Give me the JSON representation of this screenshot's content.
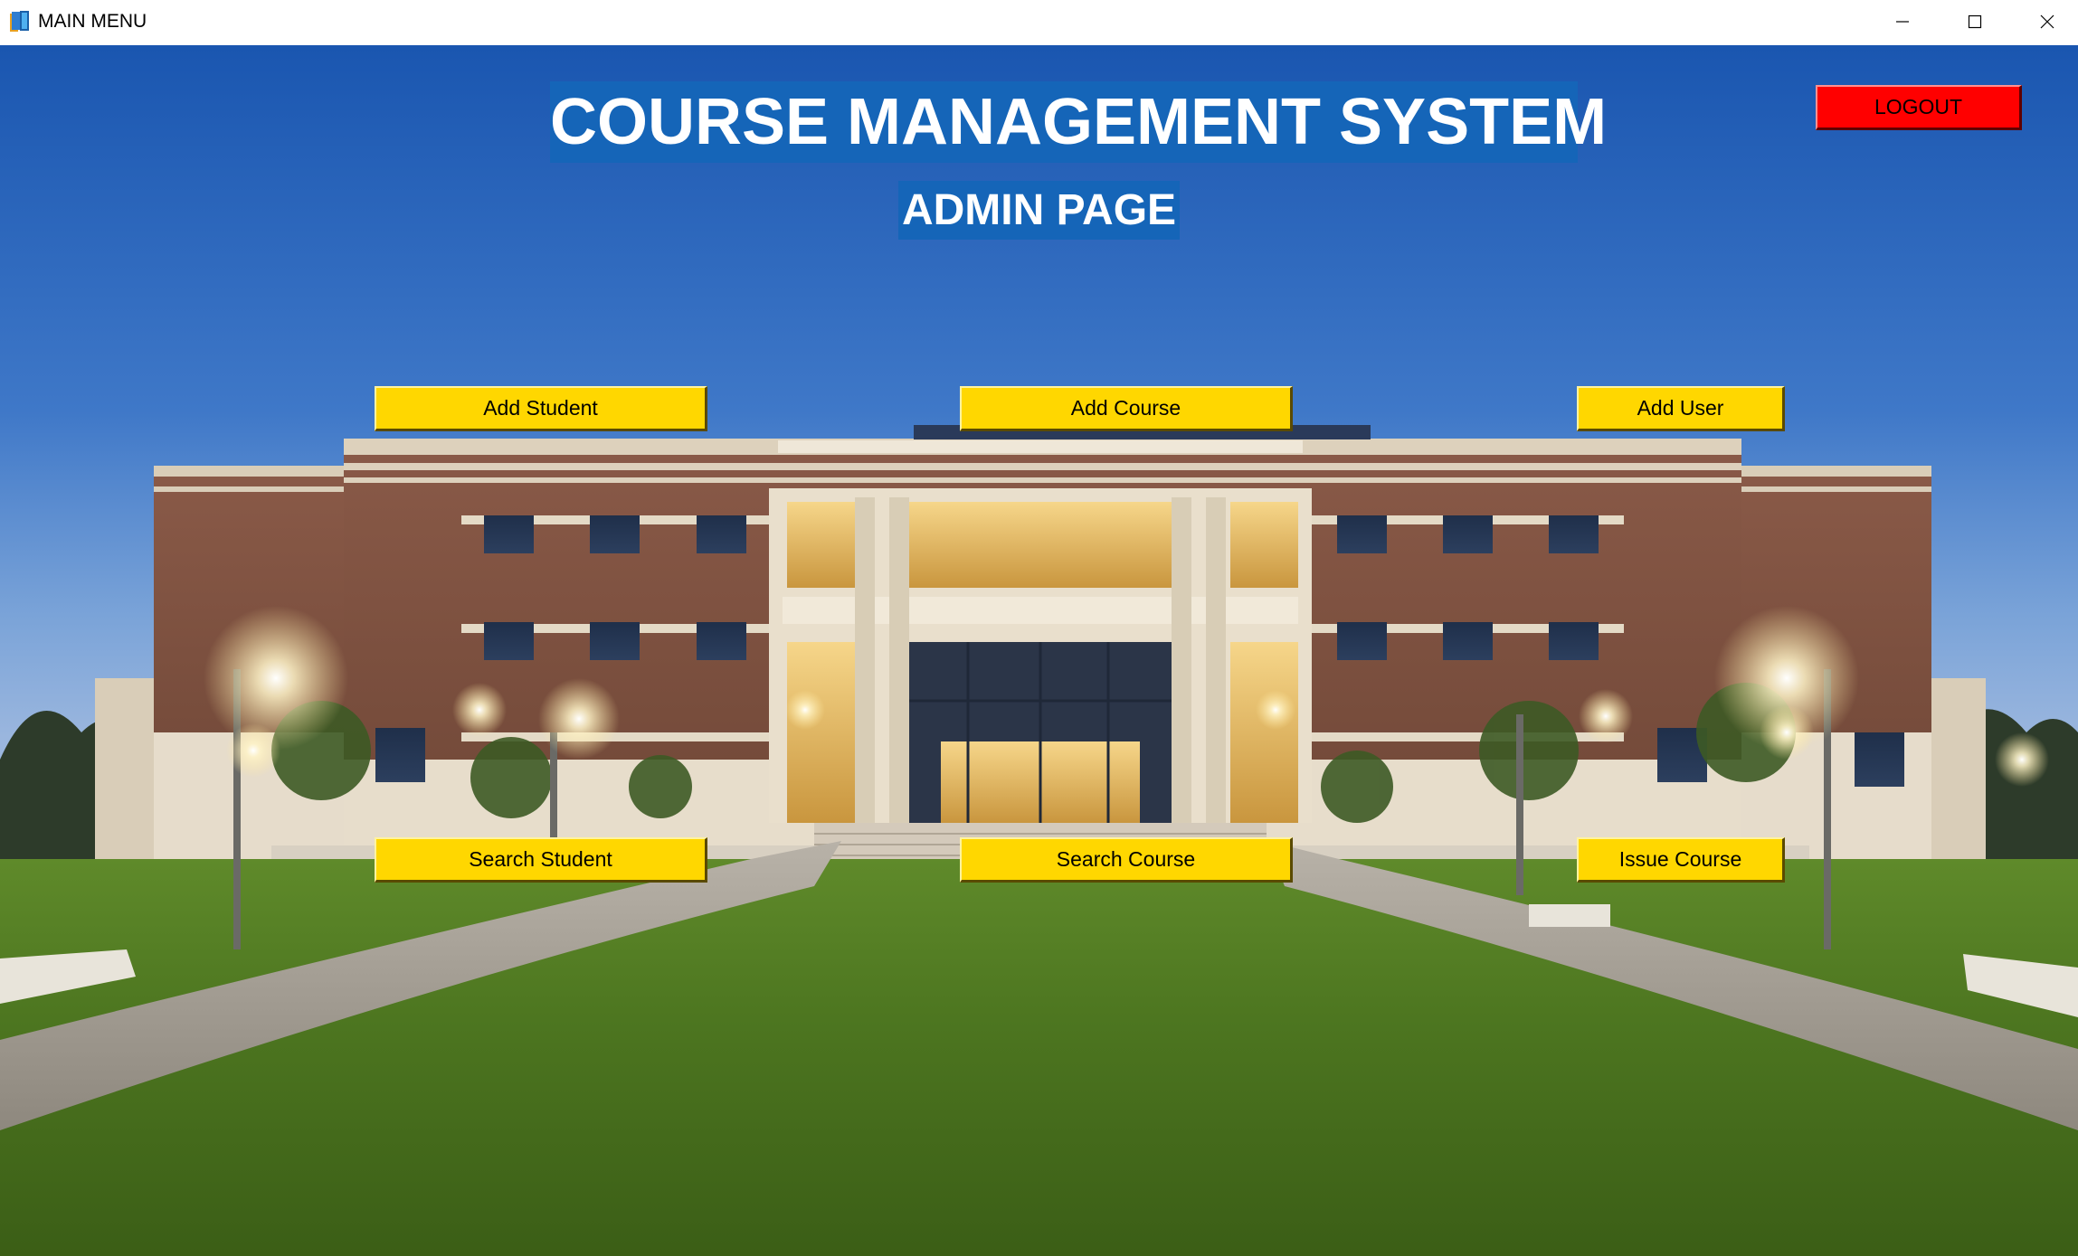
{
  "window": {
    "title": "MAIN MENU",
    "app_icon": "book-app-icon",
    "controls": [
      "minimize-icon",
      "maximize-icon",
      "close-icon"
    ]
  },
  "header": {
    "title": "COURSE MANAGEMENT SYSTEM",
    "subtitle": "ADMIN PAGE",
    "logout_label": "LOGOUT"
  },
  "actions": {
    "add_student": "Add Student",
    "add_course": "Add Course",
    "add_user": "Add User",
    "search_student": "Search Student",
    "search_course": "Search Course",
    "issue_course": "Issue Course"
  },
  "colors": {
    "heading_bg": "#1565b8",
    "button_bg": "#ffd700",
    "logout_bg": "#ff0000"
  }
}
